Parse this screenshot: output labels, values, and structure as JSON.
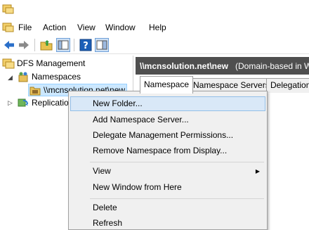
{
  "menubar": {
    "items": [
      "File",
      "Action",
      "View",
      "Window",
      "Help"
    ]
  },
  "toolbar": {
    "icons": [
      "back-arrow-icon",
      "forward-arrow-icon",
      "up-folder-icon",
      "show-hide-tree-icon",
      "help-icon",
      "properties-icon"
    ]
  },
  "tree": {
    "root": "DFS Management",
    "namespaces": "Namespaces",
    "namespace_item": "\\\\mcnsolution.net\\new",
    "replication": "Replication"
  },
  "content": {
    "header_title": "\\\\mcnsolution.net\\new",
    "header_subtitle": "(Domain-based in W",
    "tabs": [
      "Namespace",
      "Namespace Servers",
      "Delegation"
    ]
  },
  "context_menu": {
    "items": [
      "New Folder...",
      "Add Namespace Server...",
      "Delegate Management Permissions...",
      "Remove Namespace from Display...",
      "View",
      "New Window from Here",
      "Delete",
      "Refresh"
    ]
  },
  "colors": {
    "header_bar": "#4f4f4f",
    "menu_highlight": "#d9e8f7",
    "menu_bg": "#f0f0f0",
    "toolbar_blue": "#1c5fb8"
  }
}
